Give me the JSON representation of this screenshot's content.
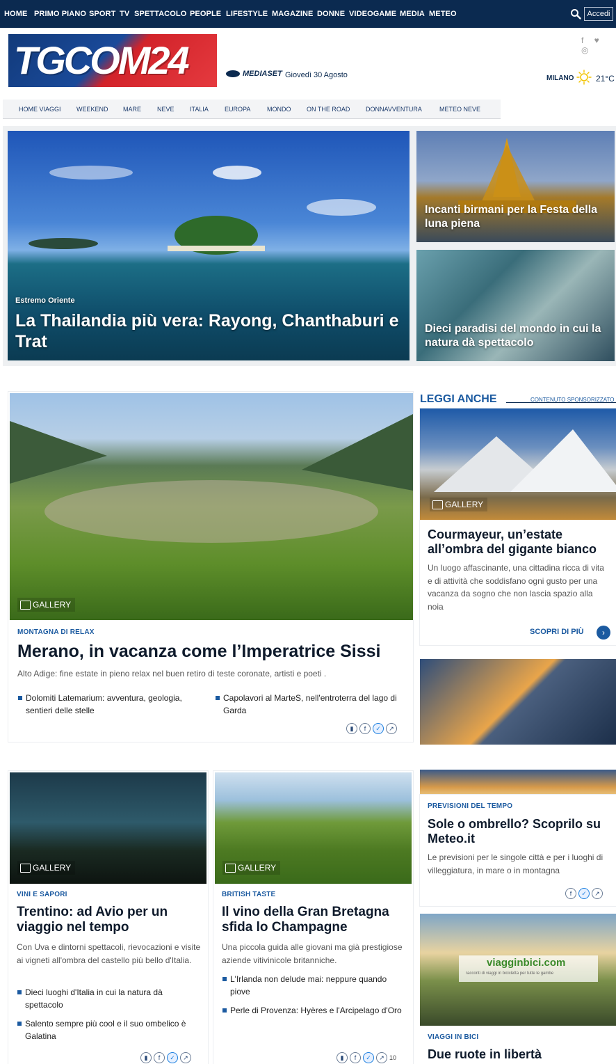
{
  "topnav": {
    "items": [
      "HOME",
      "PRIMO PIANO",
      "SPORT",
      "TV",
      "SPETTACOLO",
      "PEOPLE",
      "LIFESTYLE",
      "MAGAZINE",
      "DONNE",
      "VIDEOGAME",
      "MEDIA",
      "METEO"
    ],
    "login_label": "Accedi"
  },
  "header": {
    "logo_text": "TGCOM24",
    "network": "MEDIASET",
    "date": "Giovedì 30 Agosto",
    "social": "f ♥ ◎",
    "weather_city": "MILANO",
    "weather_temp": "21°C"
  },
  "subnav": {
    "items": [
      "HOME VIAGGI",
      "WEEKEND",
      "MARE",
      "NEVE",
      "ITALIA",
      "EUROPA",
      "MONDO",
      "ON THE ROAD",
      "DONNAVVENTURA",
      "METEO NEVE"
    ]
  },
  "hero": {
    "main": {
      "kicker": "Estremo Oriente",
      "title": "La Thailandia più vera: Rayong, Chanthaburi e Trat"
    },
    "side1": {
      "title": "Incanti birmani per la Festa della luna piena"
    },
    "side2": {
      "title": "Dieci paradisi del mondo in cui la natura dà spettacolo"
    }
  },
  "feature": {
    "gallery_label": "GALLERY",
    "kicker": "MONTAGNA DI RELAX",
    "title": "Merano, in vacanza come l’Imperatrice Sissi",
    "summary": "Alto Adige: fine estate in pieno relax nel buen retiro di teste coronate, artisti e poeti .",
    "links": [
      "Dolomiti Latemarium: avventura, geologia, sentieri delle stelle",
      "Capolavori al MarteS, nell'entroterra del lago di Garda"
    ]
  },
  "sidebar": {
    "section_title": "LEGGI ANCHE",
    "sponsored_label": "CONTENUTO SPONSORIZZATO",
    "card1": {
      "gallery_label": "GALLERY",
      "title": "Courmayeur, un’estate all’ombra del gigante bianco",
      "summary": "Un luogo affascinante, una cittadina ricca di vita e di attività che soddisfano ogni gusto per una vacanza da sogno che non lascia spazio alla noia",
      "cta": "SCOPRI DI PIÙ"
    },
    "card2": {
      "kicker": "PREVISIONI DEL TEMPO",
      "title": "Sole o ombrello? Scoprilo su Meteo.it",
      "summary": "Le previsioni per le singole città e per i luoghi di villeggiatura, in mare o in montagna"
    },
    "card3": {
      "brand": "viagginbici.com",
      "tagline": "racconti di viaggi in bicicletta per tutte le gambe",
      "kicker": "VIAGGI IN BICI",
      "title": "Due ruote in libertà"
    }
  },
  "grid": {
    "card1": {
      "gallery_label": "GALLERY",
      "kicker": "VINI E SAPORI",
      "title": "Trentino: ad Avio per un viaggio nel tempo",
      "summary": "Con Uva e dintorni spettacoli, rievocazioni e visite ai vigneti all'ombra del castello più bello d'Italia.",
      "links": [
        "Dieci luoghi d'Italia in cui la natura dà spettacolo",
        "Salento sempre più cool e il suo ombelico è Galatina"
      ]
    },
    "card2": {
      "gallery_label": "GALLERY",
      "kicker": "BRITISH TASTE",
      "title": "Il vino della Gran Bretagna sfida lo Champagne",
      "summary": "Una piccola guida alle giovani ma già prestigiose aziende vitivinicole britanniche.",
      "links": [
        "L'Irlanda non delude mai: neppure quando piove",
        "Perle di Provenza: Hyères e l'Arcipelago d'Oro"
      ],
      "share_count": "10"
    }
  },
  "colors": {
    "navy": "#0b2a50",
    "accent_blue": "#1b5aa0",
    "brand_red": "#d2232a"
  }
}
